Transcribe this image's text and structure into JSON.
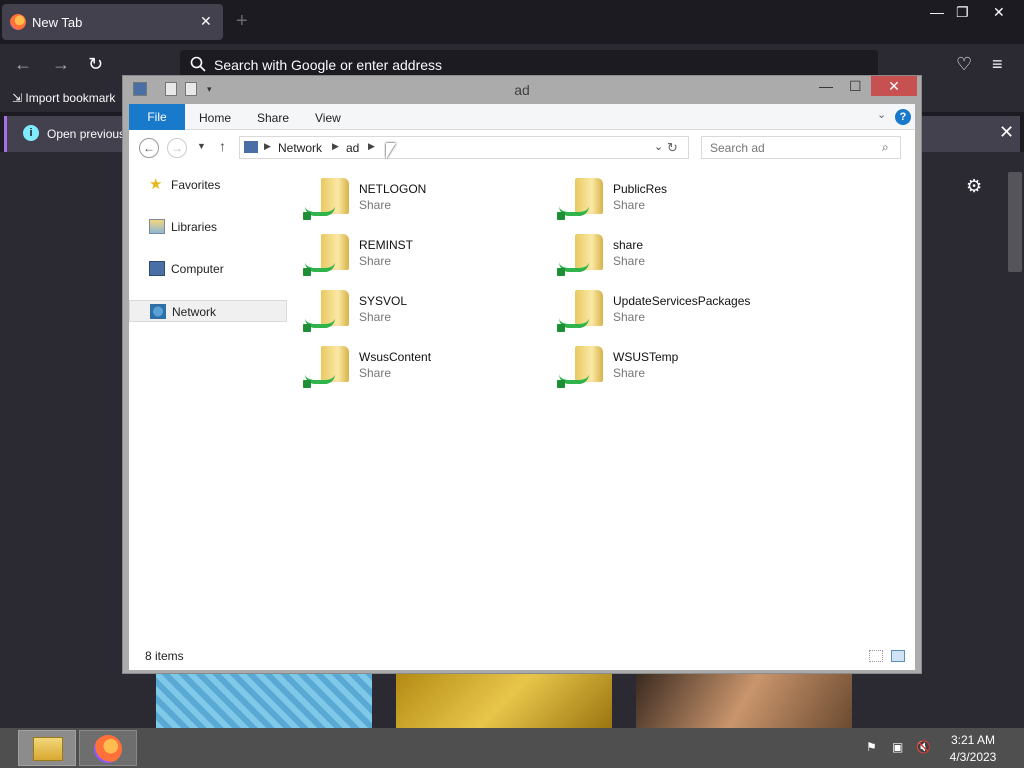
{
  "browser": {
    "tab_title": "New Tab",
    "url_placeholder": "Search with Google or enter address",
    "bookmark_import": "Import bookmark",
    "notification": "Open previous"
  },
  "explorer": {
    "window_title": "ad",
    "ribbon_tabs": [
      "File",
      "Home",
      "Share",
      "View"
    ],
    "breadcrumb": [
      "Network",
      "ad"
    ],
    "search_placeholder": "Search ad",
    "nav_items": [
      "Favorites",
      "Libraries",
      "Computer",
      "Network"
    ],
    "selected_nav": "Network",
    "shares": [
      {
        "name": "NETLOGON",
        "type": "Share"
      },
      {
        "name": "PublicRes",
        "type": "Share"
      },
      {
        "name": "REMINST",
        "type": "Share"
      },
      {
        "name": "share",
        "type": "Share"
      },
      {
        "name": "SYSVOL",
        "type": "Share"
      },
      {
        "name": "UpdateServicesPackages",
        "type": "Share"
      },
      {
        "name": "WsusContent",
        "type": "Share"
      },
      {
        "name": "WSUSTemp",
        "type": "Share"
      }
    ],
    "status_count": "8 items"
  },
  "taskbar": {
    "time": "3:21 AM",
    "date": "4/3/2023"
  },
  "colors": {
    "accent": "#1979ca",
    "close": "#c75050",
    "share_cable": "#2fb34a"
  }
}
